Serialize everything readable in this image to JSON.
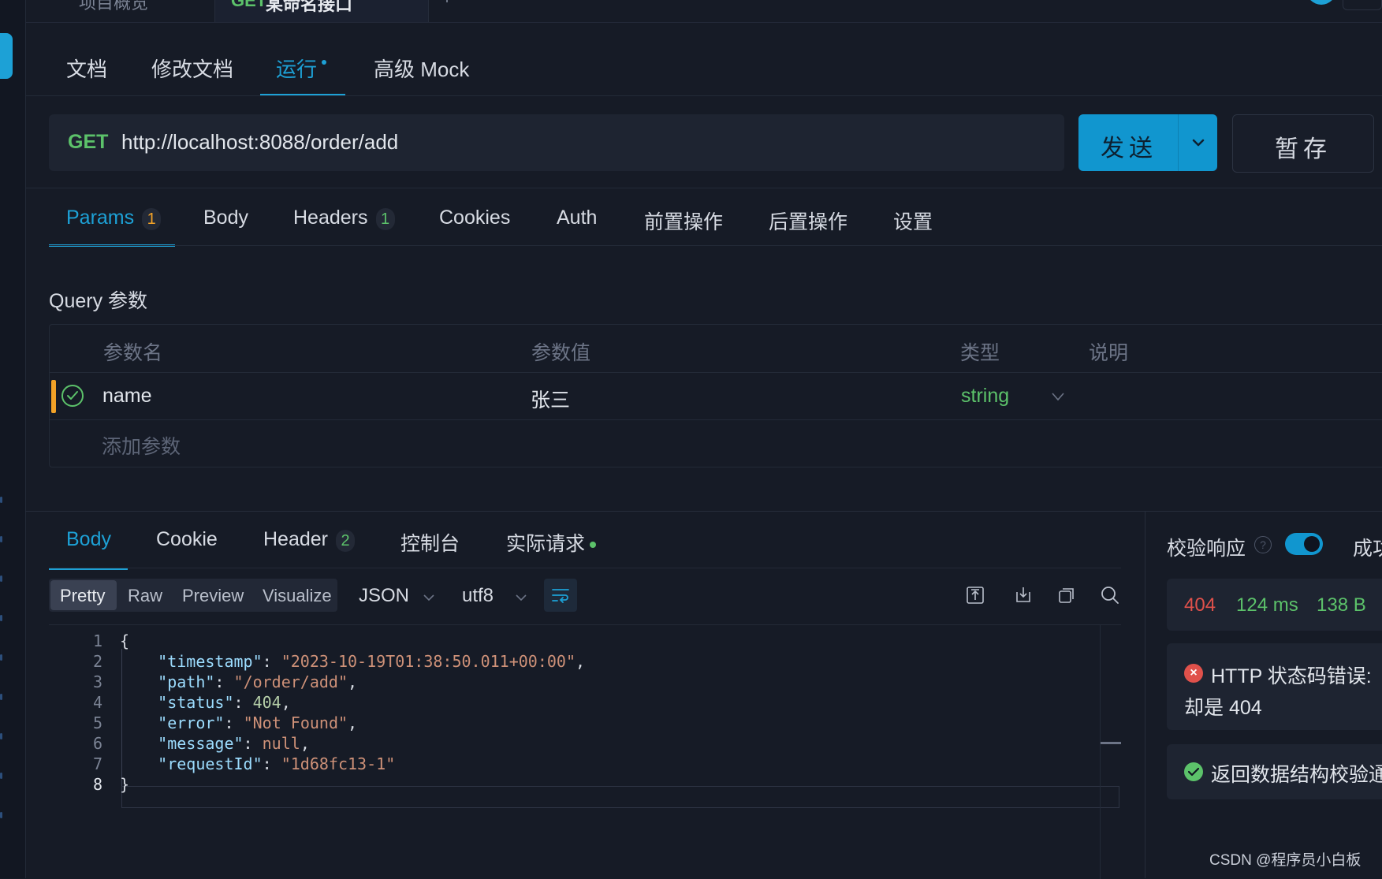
{
  "top_tabs": {
    "overview_label": "项目概览",
    "request_method": "GET",
    "request_label": "某命名接口",
    "plus": "+"
  },
  "doc_tabs": [
    {
      "label": "文档"
    },
    {
      "label": "修改文档"
    },
    {
      "label": "运行"
    },
    {
      "label": "高级 Mock"
    }
  ],
  "request": {
    "method": "GET",
    "url": "http://localhost:8088/order/add",
    "send_label": "发送",
    "save_label": "暂存"
  },
  "request_tabs": [
    {
      "label": "Params",
      "badge": "1"
    },
    {
      "label": "Body"
    },
    {
      "label": "Headers",
      "badge": "1"
    },
    {
      "label": "Cookies"
    },
    {
      "label": "Auth"
    },
    {
      "label": "前置操作"
    },
    {
      "label": "后置操作"
    },
    {
      "label": "设置"
    }
  ],
  "query": {
    "title": "Query 参数",
    "headers": {
      "name": "参数名",
      "value": "参数值",
      "type": "类型",
      "desc": "说明"
    },
    "rows": [
      {
        "name": "name",
        "value": "张三",
        "type": "string",
        "desc": ""
      }
    ],
    "add_placeholder": "添加参数"
  },
  "response_tabs": [
    {
      "label": "Body"
    },
    {
      "label": "Cookie"
    },
    {
      "label": "Header",
      "badge": "2"
    },
    {
      "label": "控制台"
    },
    {
      "label": "实际请求"
    }
  ],
  "format": {
    "modes": [
      "Pretty",
      "Raw",
      "Preview",
      "Visualize"
    ],
    "active_mode": "Pretty",
    "language": "JSON",
    "encoding": "utf8"
  },
  "code_lines": [
    "{",
    "    \"timestamp\": \"2023-10-19T01:38:50.011+00:00\",",
    "    \"path\": \"/order/add\",",
    "    \"status\": 404,",
    "    \"error\": \"Not Found\",",
    "    \"message\": null,",
    "    \"requestId\": \"1d68fc13-1\"",
    "}"
  ],
  "response_json": {
    "timestamp": "2023-10-19T01:38:50.011+00:00",
    "path": "/order/add",
    "status": 404,
    "error": "Not Found",
    "message": "null",
    "requestId": "1d68fc13-1"
  },
  "current_line": 8,
  "validation": {
    "label": "校验响应",
    "toggle_on": true,
    "extra_label": "成功",
    "status_code": "404",
    "time": "124 ms",
    "size": "138 B",
    "error_line1": "HTTP 状态码错误:",
    "error_line2": "却是 404",
    "success_text": "返回数据结构校验通过"
  },
  "watermark": "CSDN @程序员小白板",
  "colors": {
    "accent": "#1da1d6",
    "method_get": "#5cc26a",
    "error": "#e0514b",
    "success": "#5cc26a",
    "badge_orange": "#f2a227"
  }
}
